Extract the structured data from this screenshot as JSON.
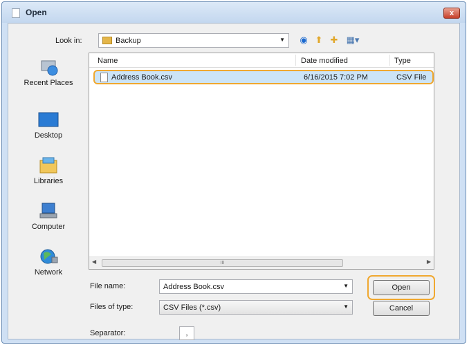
{
  "dialog": {
    "title": "Open",
    "close_symbol": "x"
  },
  "toolbar": {
    "look_in_label": "Look in:",
    "look_in_value": "Backup",
    "icons": [
      "back-icon",
      "up-folder-icon",
      "new-folder-icon",
      "view-menu-icon"
    ]
  },
  "places": [
    {
      "label": "Recent Places",
      "icon": "recent-places-icon"
    },
    {
      "label": "Desktop",
      "icon": "desktop-icon"
    },
    {
      "label": "Libraries",
      "icon": "libraries-icon"
    },
    {
      "label": "Computer",
      "icon": "computer-icon"
    },
    {
      "label": "Network",
      "icon": "network-icon"
    }
  ],
  "file_list": {
    "columns": [
      "Name",
      "Date modified",
      "Type"
    ],
    "rows": [
      {
        "name": "Address Book.csv",
        "date_modified": "6/16/2015 7:02 PM",
        "type": "CSV File"
      }
    ],
    "scroll_grip": "III"
  },
  "footer": {
    "file_name_label": "File name:",
    "file_name_value": "Address Book.csv",
    "file_type_label": "Files of type:",
    "file_type_value": "CSV Files (*.csv)",
    "separator_label": "Separator:",
    "separator_value": ","
  },
  "buttons": {
    "open": "Open",
    "cancel": "Cancel"
  },
  "colors": {
    "highlight_ring": "#f0a830",
    "selection": "#cce4f7",
    "window_frame": "#cfe0f4"
  }
}
